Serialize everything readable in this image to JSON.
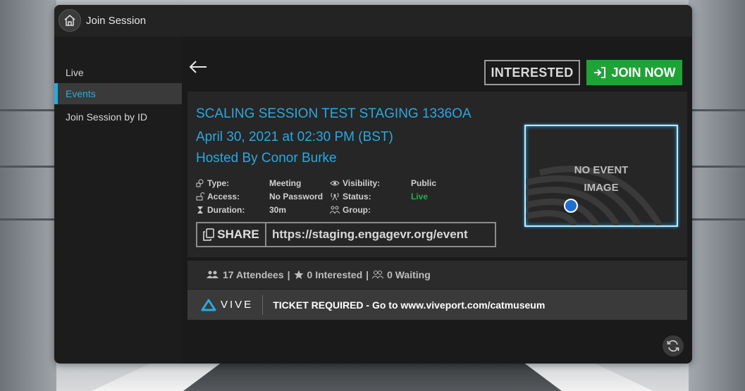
{
  "window": {
    "title": "Join Session"
  },
  "sidebar": {
    "items": [
      {
        "label": "Live",
        "active": false
      },
      {
        "label": "Events",
        "active": true
      },
      {
        "label": "Join Session by ID",
        "active": false
      }
    ]
  },
  "actions": {
    "interested": "INTERESTED",
    "join_now": "JOIN NOW"
  },
  "event": {
    "title": "SCALING SESSION TEST STAGING 1336OA",
    "date": "April 30, 2021 at 02:30 PM (BST)",
    "host": "Hosted By Conor Burke",
    "details": {
      "type_label": "Type:",
      "type_value": "Meeting",
      "access_label": "Access:",
      "access_value": "No Password",
      "duration_label": "Duration:",
      "duration_value": "30m",
      "visibility_label": "Visibility:",
      "visibility_value": "Public",
      "status_label": "Status:",
      "status_value": "Live",
      "group_label": "Group:",
      "group_value": ""
    },
    "share_label": "SHARE",
    "share_url": "https://staging.engagevr.org/event",
    "image_placeholder_line1": "NO EVENT",
    "image_placeholder_line2": "IMAGE"
  },
  "stats": {
    "attendees": "17 Attendees",
    "interested": "0 Interested",
    "waiting": "0 Waiting",
    "separator": "|"
  },
  "ticket": {
    "brand": "VIVE",
    "message": "TICKET REQUIRED - Go to www.viveport.com/catmuseum"
  },
  "colors": {
    "accent": "#29a9e1",
    "join": "#1fa336",
    "live": "#22b34a"
  }
}
